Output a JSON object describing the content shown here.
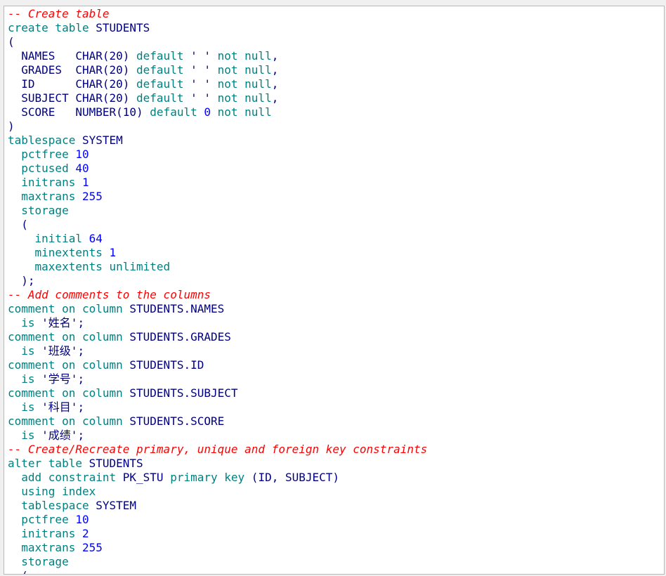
{
  "colors": {
    "comment": "#ff0000",
    "keyword": "#008080",
    "identifier": "#000080",
    "number": "#0000ff",
    "background": "#ffffff"
  },
  "lines": [
    [
      {
        "c": "cm",
        "t": "-- Create table"
      }
    ],
    [
      {
        "c": "kw",
        "t": "create table "
      },
      {
        "c": "id",
        "t": "STUDENTS"
      }
    ],
    [
      {
        "c": "pu",
        "t": "("
      }
    ],
    [
      {
        "c": "id",
        "t": "  NAMES   "
      },
      {
        "c": "ty",
        "t": "CHAR(20)"
      },
      {
        "c": "kw",
        "t": " default "
      },
      {
        "c": "str",
        "t": "' '"
      },
      {
        "c": "kw",
        "t": " not null"
      },
      {
        "c": "pu",
        "t": ","
      }
    ],
    [
      {
        "c": "id",
        "t": "  GRADES  "
      },
      {
        "c": "ty",
        "t": "CHAR(20)"
      },
      {
        "c": "kw",
        "t": " default "
      },
      {
        "c": "str",
        "t": "' '"
      },
      {
        "c": "kw",
        "t": " not null"
      },
      {
        "c": "pu",
        "t": ","
      }
    ],
    [
      {
        "c": "id",
        "t": "  ID      "
      },
      {
        "c": "ty",
        "t": "CHAR(20)"
      },
      {
        "c": "kw",
        "t": " default "
      },
      {
        "c": "str",
        "t": "' '"
      },
      {
        "c": "kw",
        "t": " not null"
      },
      {
        "c": "pu",
        "t": ","
      }
    ],
    [
      {
        "c": "id",
        "t": "  SUBJECT "
      },
      {
        "c": "ty",
        "t": "CHAR(20)"
      },
      {
        "c": "kw",
        "t": " default "
      },
      {
        "c": "str",
        "t": "' '"
      },
      {
        "c": "kw",
        "t": " not null"
      },
      {
        "c": "pu",
        "t": ","
      }
    ],
    [
      {
        "c": "id",
        "t": "  SCORE   "
      },
      {
        "c": "ty",
        "t": "NUMBER(10)"
      },
      {
        "c": "kw",
        "t": " default "
      },
      {
        "c": "num",
        "t": "0"
      },
      {
        "c": "kw",
        "t": " not null"
      }
    ],
    [
      {
        "c": "pu",
        "t": ")"
      }
    ],
    [
      {
        "c": "kw",
        "t": "tablespace "
      },
      {
        "c": "id",
        "t": "SYSTEM"
      }
    ],
    [
      {
        "c": "kw",
        "t": "  pctfree "
      },
      {
        "c": "num",
        "t": "10"
      }
    ],
    [
      {
        "c": "kw",
        "t": "  pctused "
      },
      {
        "c": "num",
        "t": "40"
      }
    ],
    [
      {
        "c": "kw",
        "t": "  initrans "
      },
      {
        "c": "num",
        "t": "1"
      }
    ],
    [
      {
        "c": "kw",
        "t": "  maxtrans "
      },
      {
        "c": "num",
        "t": "255"
      }
    ],
    [
      {
        "c": "kw",
        "t": "  storage"
      }
    ],
    [
      {
        "c": "pu",
        "t": "  ("
      }
    ],
    [
      {
        "c": "kw",
        "t": "    initial "
      },
      {
        "c": "num",
        "t": "64"
      }
    ],
    [
      {
        "c": "kw",
        "t": "    minextents "
      },
      {
        "c": "num",
        "t": "1"
      }
    ],
    [
      {
        "c": "kw",
        "t": "    maxextents unlimited"
      }
    ],
    [
      {
        "c": "pu",
        "t": "  );"
      }
    ],
    [
      {
        "c": "cm",
        "t": "-- Add comments to the columns"
      }
    ],
    [
      {
        "c": "kw",
        "t": "comment on column "
      },
      {
        "c": "id",
        "t": "STUDENTS.NAMES"
      }
    ],
    [
      {
        "c": "kw",
        "t": "  is "
      },
      {
        "c": "str",
        "t": "'姓名'"
      },
      {
        "c": "pu",
        "t": ";"
      }
    ],
    [
      {
        "c": "kw",
        "t": "comment on column "
      },
      {
        "c": "id",
        "t": "STUDENTS.GRADES"
      }
    ],
    [
      {
        "c": "kw",
        "t": "  is "
      },
      {
        "c": "str",
        "t": "'班级'"
      },
      {
        "c": "pu",
        "t": ";"
      }
    ],
    [
      {
        "c": "kw",
        "t": "comment on column "
      },
      {
        "c": "id",
        "t": "STUDENTS.ID"
      }
    ],
    [
      {
        "c": "kw",
        "t": "  is "
      },
      {
        "c": "str",
        "t": "'学号'"
      },
      {
        "c": "pu",
        "t": ";"
      }
    ],
    [
      {
        "c": "kw",
        "t": "comment on column "
      },
      {
        "c": "id",
        "t": "STUDENTS.SUBJECT"
      }
    ],
    [
      {
        "c": "kw",
        "t": "  is "
      },
      {
        "c": "str",
        "t": "'科目'"
      },
      {
        "c": "pu",
        "t": ";"
      }
    ],
    [
      {
        "c": "kw",
        "t": "comment on column "
      },
      {
        "c": "id",
        "t": "STUDENTS.SCORE"
      }
    ],
    [
      {
        "c": "kw",
        "t": "  is "
      },
      {
        "c": "str",
        "t": "'成绩'"
      },
      {
        "c": "pu",
        "t": ";"
      }
    ],
    [
      {
        "c": "cm",
        "t": "-- Create/Recreate primary, unique and foreign key constraints"
      }
    ],
    [
      {
        "c": "kw",
        "t": "alter table "
      },
      {
        "c": "id",
        "t": "STUDENTS"
      }
    ],
    [
      {
        "c": "kw",
        "t": "  add constraint "
      },
      {
        "c": "id",
        "t": "PK_STU"
      },
      {
        "c": "kw",
        "t": " primary key "
      },
      {
        "c": "pu",
        "t": "("
      },
      {
        "c": "id",
        "t": "ID"
      },
      {
        "c": "pu",
        "t": ", "
      },
      {
        "c": "id",
        "t": "SUBJECT"
      },
      {
        "c": "pu",
        "t": ")"
      }
    ],
    [
      {
        "c": "kw",
        "t": "  using index"
      }
    ],
    [
      {
        "c": "kw",
        "t": "  tablespace "
      },
      {
        "c": "id",
        "t": "SYSTEM"
      }
    ],
    [
      {
        "c": "kw",
        "t": "  pctfree "
      },
      {
        "c": "num",
        "t": "10"
      }
    ],
    [
      {
        "c": "kw",
        "t": "  initrans "
      },
      {
        "c": "num",
        "t": "2"
      }
    ],
    [
      {
        "c": "kw",
        "t": "  maxtrans "
      },
      {
        "c": "num",
        "t": "255"
      }
    ],
    [
      {
        "c": "kw",
        "t": "  storage"
      }
    ],
    [
      {
        "c": "pu",
        "t": "  ("
      }
    ]
  ]
}
